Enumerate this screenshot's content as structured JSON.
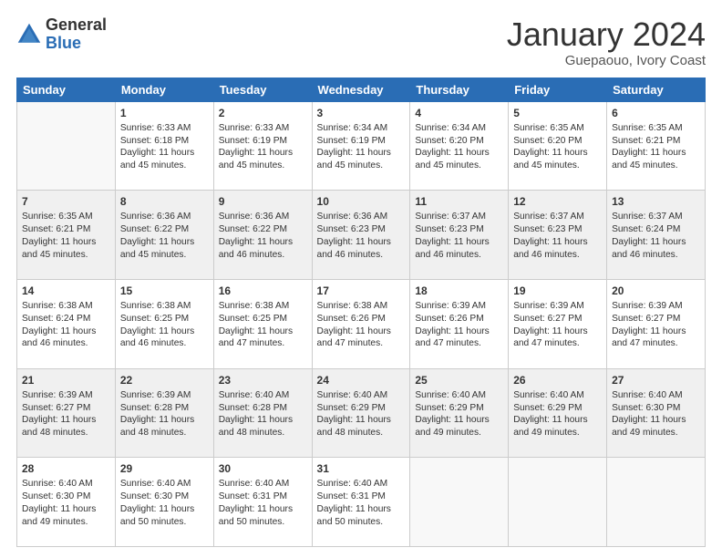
{
  "logo": {
    "general": "General",
    "blue": "Blue"
  },
  "header": {
    "month": "January 2024",
    "location": "Guepaouo, Ivory Coast"
  },
  "weekdays": [
    "Sunday",
    "Monday",
    "Tuesday",
    "Wednesday",
    "Thursday",
    "Friday",
    "Saturday"
  ],
  "weeks": [
    [
      {
        "day": "",
        "sunrise": "",
        "sunset": "",
        "daylight": ""
      },
      {
        "day": "1",
        "sunrise": "Sunrise: 6:33 AM",
        "sunset": "Sunset: 6:18 PM",
        "daylight": "Daylight: 11 hours and 45 minutes."
      },
      {
        "day": "2",
        "sunrise": "Sunrise: 6:33 AM",
        "sunset": "Sunset: 6:19 PM",
        "daylight": "Daylight: 11 hours and 45 minutes."
      },
      {
        "day": "3",
        "sunrise": "Sunrise: 6:34 AM",
        "sunset": "Sunset: 6:19 PM",
        "daylight": "Daylight: 11 hours and 45 minutes."
      },
      {
        "day": "4",
        "sunrise": "Sunrise: 6:34 AM",
        "sunset": "Sunset: 6:20 PM",
        "daylight": "Daylight: 11 hours and 45 minutes."
      },
      {
        "day": "5",
        "sunrise": "Sunrise: 6:35 AM",
        "sunset": "Sunset: 6:20 PM",
        "daylight": "Daylight: 11 hours and 45 minutes."
      },
      {
        "day": "6",
        "sunrise": "Sunrise: 6:35 AM",
        "sunset": "Sunset: 6:21 PM",
        "daylight": "Daylight: 11 hours and 45 minutes."
      }
    ],
    [
      {
        "day": "7",
        "sunrise": "Sunrise: 6:35 AM",
        "sunset": "Sunset: 6:21 PM",
        "daylight": "Daylight: 11 hours and 45 minutes."
      },
      {
        "day": "8",
        "sunrise": "Sunrise: 6:36 AM",
        "sunset": "Sunset: 6:22 PM",
        "daylight": "Daylight: 11 hours and 45 minutes."
      },
      {
        "day": "9",
        "sunrise": "Sunrise: 6:36 AM",
        "sunset": "Sunset: 6:22 PM",
        "daylight": "Daylight: 11 hours and 46 minutes."
      },
      {
        "day": "10",
        "sunrise": "Sunrise: 6:36 AM",
        "sunset": "Sunset: 6:23 PM",
        "daylight": "Daylight: 11 hours and 46 minutes."
      },
      {
        "day": "11",
        "sunrise": "Sunrise: 6:37 AM",
        "sunset": "Sunset: 6:23 PM",
        "daylight": "Daylight: 11 hours and 46 minutes."
      },
      {
        "day": "12",
        "sunrise": "Sunrise: 6:37 AM",
        "sunset": "Sunset: 6:23 PM",
        "daylight": "Daylight: 11 hours and 46 minutes."
      },
      {
        "day": "13",
        "sunrise": "Sunrise: 6:37 AM",
        "sunset": "Sunset: 6:24 PM",
        "daylight": "Daylight: 11 hours and 46 minutes."
      }
    ],
    [
      {
        "day": "14",
        "sunrise": "Sunrise: 6:38 AM",
        "sunset": "Sunset: 6:24 PM",
        "daylight": "Daylight: 11 hours and 46 minutes."
      },
      {
        "day": "15",
        "sunrise": "Sunrise: 6:38 AM",
        "sunset": "Sunset: 6:25 PM",
        "daylight": "Daylight: 11 hours and 46 minutes."
      },
      {
        "day": "16",
        "sunrise": "Sunrise: 6:38 AM",
        "sunset": "Sunset: 6:25 PM",
        "daylight": "Daylight: 11 hours and 47 minutes."
      },
      {
        "day": "17",
        "sunrise": "Sunrise: 6:38 AM",
        "sunset": "Sunset: 6:26 PM",
        "daylight": "Daylight: 11 hours and 47 minutes."
      },
      {
        "day": "18",
        "sunrise": "Sunrise: 6:39 AM",
        "sunset": "Sunset: 6:26 PM",
        "daylight": "Daylight: 11 hours and 47 minutes."
      },
      {
        "day": "19",
        "sunrise": "Sunrise: 6:39 AM",
        "sunset": "Sunset: 6:27 PM",
        "daylight": "Daylight: 11 hours and 47 minutes."
      },
      {
        "day": "20",
        "sunrise": "Sunrise: 6:39 AM",
        "sunset": "Sunset: 6:27 PM",
        "daylight": "Daylight: 11 hours and 47 minutes."
      }
    ],
    [
      {
        "day": "21",
        "sunrise": "Sunrise: 6:39 AM",
        "sunset": "Sunset: 6:27 PM",
        "daylight": "Daylight: 11 hours and 48 minutes."
      },
      {
        "day": "22",
        "sunrise": "Sunrise: 6:39 AM",
        "sunset": "Sunset: 6:28 PM",
        "daylight": "Daylight: 11 hours and 48 minutes."
      },
      {
        "day": "23",
        "sunrise": "Sunrise: 6:40 AM",
        "sunset": "Sunset: 6:28 PM",
        "daylight": "Daylight: 11 hours and 48 minutes."
      },
      {
        "day": "24",
        "sunrise": "Sunrise: 6:40 AM",
        "sunset": "Sunset: 6:29 PM",
        "daylight": "Daylight: 11 hours and 48 minutes."
      },
      {
        "day": "25",
        "sunrise": "Sunrise: 6:40 AM",
        "sunset": "Sunset: 6:29 PM",
        "daylight": "Daylight: 11 hours and 49 minutes."
      },
      {
        "day": "26",
        "sunrise": "Sunrise: 6:40 AM",
        "sunset": "Sunset: 6:29 PM",
        "daylight": "Daylight: 11 hours and 49 minutes."
      },
      {
        "day": "27",
        "sunrise": "Sunrise: 6:40 AM",
        "sunset": "Sunset: 6:30 PM",
        "daylight": "Daylight: 11 hours and 49 minutes."
      }
    ],
    [
      {
        "day": "28",
        "sunrise": "Sunrise: 6:40 AM",
        "sunset": "Sunset: 6:30 PM",
        "daylight": "Daylight: 11 hours and 49 minutes."
      },
      {
        "day": "29",
        "sunrise": "Sunrise: 6:40 AM",
        "sunset": "Sunset: 6:30 PM",
        "daylight": "Daylight: 11 hours and 50 minutes."
      },
      {
        "day": "30",
        "sunrise": "Sunrise: 6:40 AM",
        "sunset": "Sunset: 6:31 PM",
        "daylight": "Daylight: 11 hours and 50 minutes."
      },
      {
        "day": "31",
        "sunrise": "Sunrise: 6:40 AM",
        "sunset": "Sunset: 6:31 PM",
        "daylight": "Daylight: 11 hours and 50 minutes."
      },
      {
        "day": "",
        "sunrise": "",
        "sunset": "",
        "daylight": ""
      },
      {
        "day": "",
        "sunrise": "",
        "sunset": "",
        "daylight": ""
      },
      {
        "day": "",
        "sunrise": "",
        "sunset": "",
        "daylight": ""
      }
    ]
  ]
}
